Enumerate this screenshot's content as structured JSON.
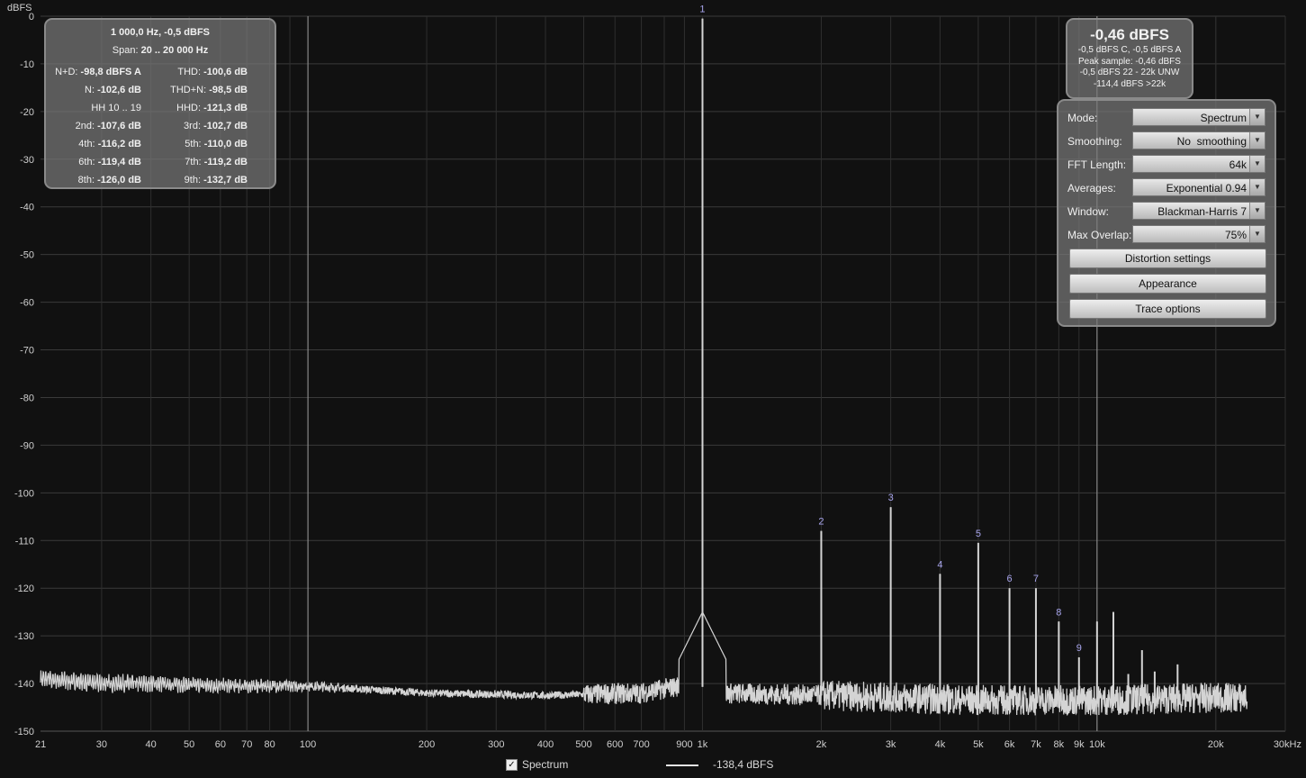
{
  "chart_data": {
    "type": "line",
    "title": "",
    "ylabel": "dBFS",
    "xlabel": "",
    "xscale": "log",
    "xlim": [
      21,
      30000
    ],
    "ylim": [
      -150,
      0
    ],
    "grid": true,
    "y_ticks": [
      0,
      -10,
      -20,
      -30,
      -40,
      -50,
      -60,
      -70,
      -80,
      -90,
      -100,
      -110,
      -120,
      -130,
      -140,
      -150
    ],
    "x_ticks": [
      {
        "value": 21,
        "label": "21"
      },
      {
        "value": 30,
        "label": "30"
      },
      {
        "value": 40,
        "label": "40"
      },
      {
        "value": 50,
        "label": "50"
      },
      {
        "value": 60,
        "label": "60"
      },
      {
        "value": 70,
        "label": "70"
      },
      {
        "value": 80,
        "label": "80"
      },
      {
        "value": 100,
        "label": "100"
      },
      {
        "value": 200,
        "label": "200"
      },
      {
        "value": 300,
        "label": "300"
      },
      {
        "value": 400,
        "label": "400"
      },
      {
        "value": 500,
        "label": "500"
      },
      {
        "value": 600,
        "label": "600"
      },
      {
        "value": 700,
        "label": "700"
      },
      {
        "value": 900,
        "label": "900"
      },
      {
        "value": 1000,
        "label": "1k"
      },
      {
        "value": 2000,
        "label": "2k"
      },
      {
        "value": 3000,
        "label": "3k"
      },
      {
        "value": 4000,
        "label": "4k"
      },
      {
        "value": 5000,
        "label": "5k"
      },
      {
        "value": 6000,
        "label": "6k"
      },
      {
        "value": 7000,
        "label": "7k"
      },
      {
        "value": 8000,
        "label": "8k"
      },
      {
        "value": 9000,
        "label": "9k"
      },
      {
        "value": 10000,
        "label": "10k"
      },
      {
        "value": 20000,
        "label": "20k"
      },
      {
        "value": 30000,
        "label": "30kHz"
      }
    ],
    "markers_x": [
      100,
      10000
    ],
    "series": [
      {
        "name": "Spectrum",
        "color": "#d4d4d4",
        "noise_floor": [
          [
            21,
            -139
          ],
          [
            30,
            -140
          ],
          [
            40,
            -140
          ],
          [
            60,
            -140.5
          ],
          [
            100,
            -140.5
          ],
          [
            200,
            -142
          ],
          [
            400,
            -142.5
          ],
          [
            700,
            -142
          ],
          [
            950,
            -140
          ],
          [
            1100,
            -142
          ],
          [
            2000,
            -142.5
          ],
          [
            5000,
            -143.5
          ],
          [
            10000,
            -143.5
          ],
          [
            20000,
            -143
          ],
          [
            24000,
            -143
          ]
        ],
        "peaks": [
          {
            "label": "1",
            "x": 1000,
            "y": -0.5
          },
          {
            "label": "2",
            "x": 2000,
            "y": -108
          },
          {
            "label": "3",
            "x": 3000,
            "y": -103
          },
          {
            "label": "4",
            "x": 4000,
            "y": -117
          },
          {
            "label": "5",
            "x": 5000,
            "y": -110.5
          },
          {
            "label": "6",
            "x": 6000,
            "y": -120
          },
          {
            "label": "7",
            "x": 7000,
            "y": -120
          },
          {
            "label": "8",
            "x": 8000,
            "y": -127
          },
          {
            "label": "9",
            "x": 9000,
            "y": -134.5
          },
          {
            "label": "",
            "x": 10000,
            "y": -127
          },
          {
            "label": "",
            "x": 11000,
            "y": -125
          },
          {
            "label": "",
            "x": 12000,
            "y": -138
          },
          {
            "label": "",
            "x": 13000,
            "y": -133
          },
          {
            "label": "",
            "x": 14000,
            "y": -137.5
          },
          {
            "label": "",
            "x": 16000,
            "y": -136
          }
        ]
      }
    ]
  },
  "stats": {
    "header1": "1 000,0 Hz, -0,5 dBFS",
    "span_label": "Span:",
    "span_value": "20 .. 20 000 Hz",
    "rows": [
      {
        "l_label": "N+D:",
        "l_value": "-98,8 dBFS A",
        "r_label": "THD:",
        "r_value": "-100,6 dB"
      },
      {
        "l_label": "N:",
        "l_value": "-102,6 dB",
        "r_label": "THD+N:",
        "r_value": "-98,5 dB"
      },
      {
        "l_label": "HH 10 .. 19",
        "l_value": "",
        "r_label": "HHD:",
        "r_value": "-121,3 dB"
      },
      {
        "l_label": "2nd:",
        "l_value": "-107,6 dB",
        "r_label": "3rd:",
        "r_value": "-102,7 dB"
      },
      {
        "l_label": "4th:",
        "l_value": "-116,2 dB",
        "r_label": "5th:",
        "r_value": "-110,0 dB"
      },
      {
        "l_label": "6th:",
        "l_value": "-119,4 dB",
        "r_label": "7th:",
        "r_value": "-119,2 dB"
      },
      {
        "l_label": "8th:",
        "l_value": "-126,0 dB",
        "r_label": "9th:",
        "r_value": "-132,7 dB"
      }
    ]
  },
  "level": {
    "big": "-0,46 dBFS",
    "line1": "-0,5 dBFS C, -0,5 dBFS A",
    "line2": "Peak sample: -0,46 dBFS",
    "line3": "-0,5 dBFS 22 - 22k UNW",
    "line4": "-114,4 dBFS >22k"
  },
  "settings": {
    "rows": [
      {
        "label": "Mode:",
        "value": "Spectrum"
      },
      {
        "label": "Smoothing:",
        "value": "No  smoothing"
      },
      {
        "label": "FFT Length:",
        "value": "64k"
      },
      {
        "label": "Averages:",
        "value": "Exponential 0.94"
      },
      {
        "label": "Window:",
        "value": "Blackman-Harris 7"
      },
      {
        "label": "Max Overlap:",
        "value": "75%"
      }
    ],
    "buttons": [
      "Distortion settings",
      "Appearance",
      "Trace options"
    ]
  },
  "legend": {
    "checked": true,
    "check_glyph": "✓",
    "label": "Spectrum",
    "value": "-138,4 dBFS"
  }
}
